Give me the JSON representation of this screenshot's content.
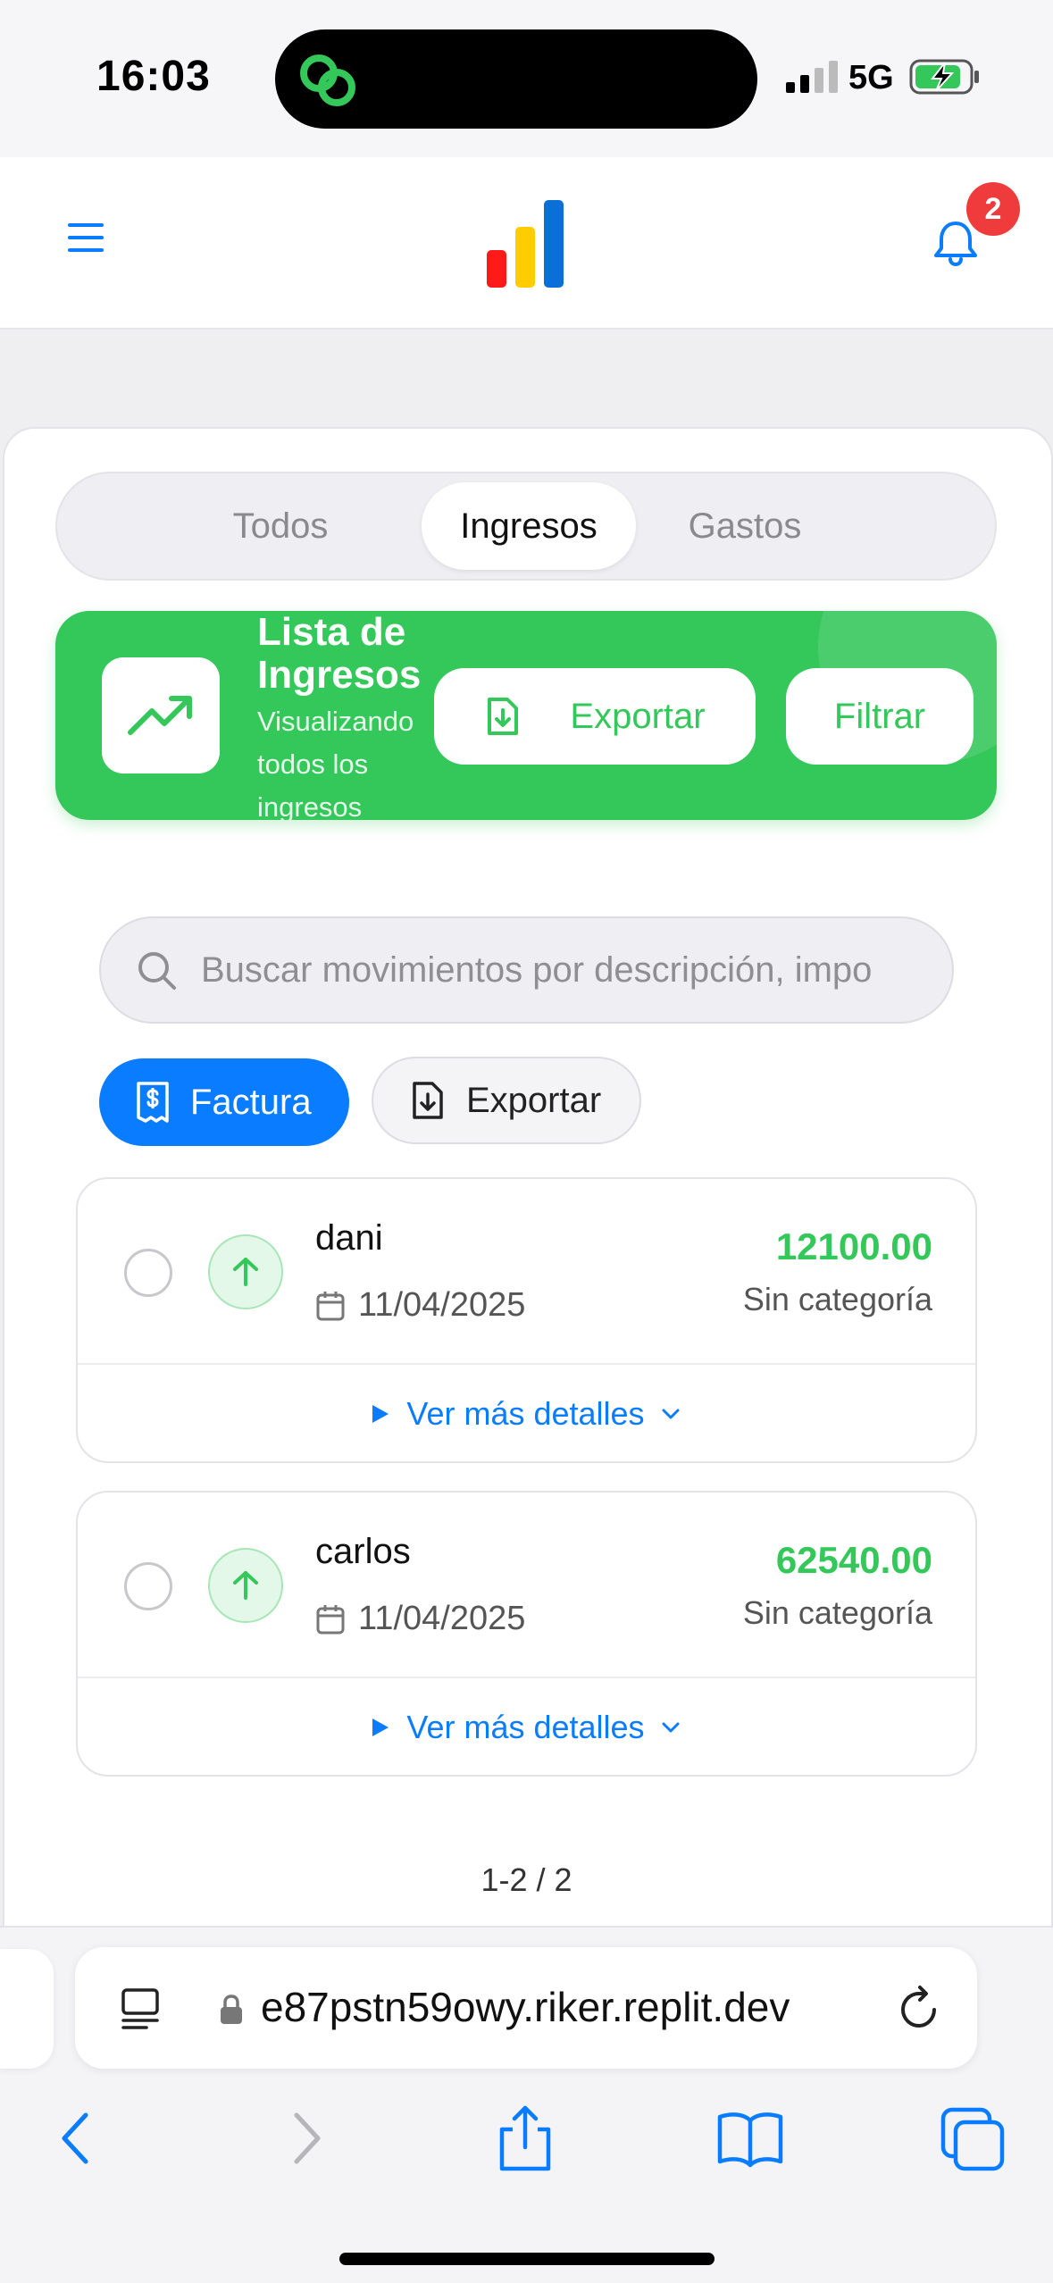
{
  "status_bar": {
    "time": "16:03",
    "network": "5G"
  },
  "header": {
    "notification_count": "2"
  },
  "tabs": [
    {
      "label": "Todos",
      "active": false
    },
    {
      "label": "Ingresos",
      "active": true
    },
    {
      "label": "Gastos",
      "active": false
    }
  ],
  "banner": {
    "title": "Lista de Ingresos",
    "subtitle": "Visualizando todos los ingresos",
    "export_label": "Exportar",
    "filter_label": "Filtrar",
    "color": "#34c759"
  },
  "search": {
    "placeholder": "Buscar movimientos por descripción, impo"
  },
  "actions": {
    "factura_label": "Factura",
    "export_label": "Exportar"
  },
  "transactions": [
    {
      "name": "dani",
      "date": "11/04/2025",
      "amount": "12100.00",
      "category": "Sin categoría",
      "details_label": "Ver más detalles"
    },
    {
      "name": "carlos",
      "date": "11/04/2025",
      "amount": "62540.00",
      "category": "Sin categoría",
      "details_label": "Ver más detalles"
    }
  ],
  "pagination": {
    "text": "1-2 / 2"
  },
  "browser": {
    "url": "e87pstn59owy.riker.replit.dev"
  },
  "colors": {
    "accent": "#0a7cff",
    "income": "#34c759",
    "badge": "#ef3b3b"
  }
}
